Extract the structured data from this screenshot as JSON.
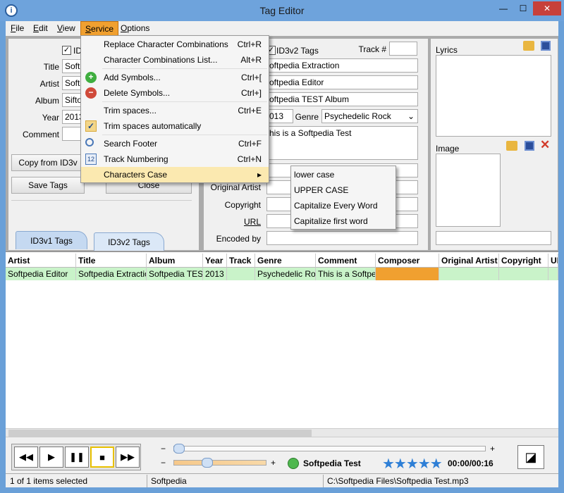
{
  "window": {
    "title": "Tag Editor",
    "min": "—",
    "max": "☐",
    "close": "✕"
  },
  "menubar": {
    "file": {
      "u": "F",
      "rest": "ile"
    },
    "edit": {
      "u": "E",
      "rest": "dit"
    },
    "view": {
      "u": "V",
      "rest": "iew"
    },
    "service": {
      "u": "S",
      "rest": "ervice"
    },
    "options": {
      "u": "O",
      "rest": "ptions"
    }
  },
  "service_menu": [
    {
      "label": "Replace Character Combinations",
      "shortcut": "Ctrl+R",
      "icon": ""
    },
    {
      "label": "Character Combinations List...",
      "shortcut": "Alt+R",
      "icon": ""
    },
    {
      "label": "Add Symbols...",
      "shortcut": "Ctrl+[",
      "icon": "plus-icon"
    },
    {
      "label": "Delete Symbols...",
      "shortcut": "Ctrl+]",
      "icon": "minus-icon"
    },
    {
      "label": "Trim spaces...",
      "shortcut": "Ctrl+E",
      "icon": ""
    },
    {
      "label": "Trim spaces automatically",
      "shortcut": "",
      "icon": "check-icon"
    },
    {
      "label": "Search Footer",
      "shortcut": "Ctrl+F",
      "icon": "magnifier-icon"
    },
    {
      "label": "Track Numbering",
      "shortcut": "Ctrl+N",
      "icon": "numbering-icon"
    },
    {
      "label": "Characters Case",
      "shortcut": "▸",
      "icon": ""
    }
  ],
  "case_submenu": [
    "lower case",
    "UPPER CASE",
    "Capitalize Every Word",
    "Capitalize first word"
  ],
  "id3v1": {
    "enable_label": "ID",
    "title_label": "Title",
    "title_value": "Softp",
    "artist_label": "Artist",
    "artist_value": "Softp",
    "album_label": "Album",
    "album_value": "Sifto",
    "year_label": "Year",
    "year_value": "2013",
    "comment_label": "Comment",
    "copy_button": "Copy from ID3v",
    "save_button": "Save Tags",
    "close_button": "Close",
    "tab1": "ID3v1 Tags",
    "tab2": "ID3v2 Tags"
  },
  "id3v2": {
    "enable_label": "ID3v2 Tags",
    "track_label": "Track #",
    "title_value": "oftpedia Extraction",
    "artist_value": "oftpedia Editor",
    "album_value": "oftpedia TEST Album",
    "year_value": "013",
    "genre_label": "Genre",
    "genre_value": "Psychedelic Rock",
    "comment_value": "his is a Softpedia Test",
    "original_artist_label": "Original Artist",
    "copyright_label": "Copyright",
    "url_label": "URL",
    "encoded_by_label": "Encoded by"
  },
  "right": {
    "lyrics_label": "Lyrics",
    "image_label": "Image"
  },
  "table": {
    "columns": [
      "Artist",
      "Title",
      "Album",
      "Year",
      "Track",
      "Genre",
      "Comment",
      "Composer",
      "Original Artist",
      "Copyright",
      "UI"
    ],
    "row": [
      "Softpedia Editor",
      "Softpedia Extraction",
      "Softpedia TEST",
      "2013",
      "",
      "Psychedelic Rock",
      "This is a Softped",
      "",
      "",
      "",
      ""
    ]
  },
  "player": {
    "prev": "◀◀",
    "play": "▶",
    "pause": "❚❚",
    "stop": "■",
    "next": "▶▶",
    "track_name": "Softpedia Test",
    "time": "00:00/00:16",
    "stars": "★★★★★",
    "rating": 5,
    "minus": "−",
    "plus": "+"
  },
  "status": {
    "selected": "1 of 1 items selected",
    "artist": "Softpedia",
    "path": "C:\\Softpedia Files\\Softpedia Test.mp3"
  },
  "colors": {
    "menu_highlight": "#f0a030",
    "row_bg": "#c9f3c9",
    "accent": "#6ea3dc"
  }
}
